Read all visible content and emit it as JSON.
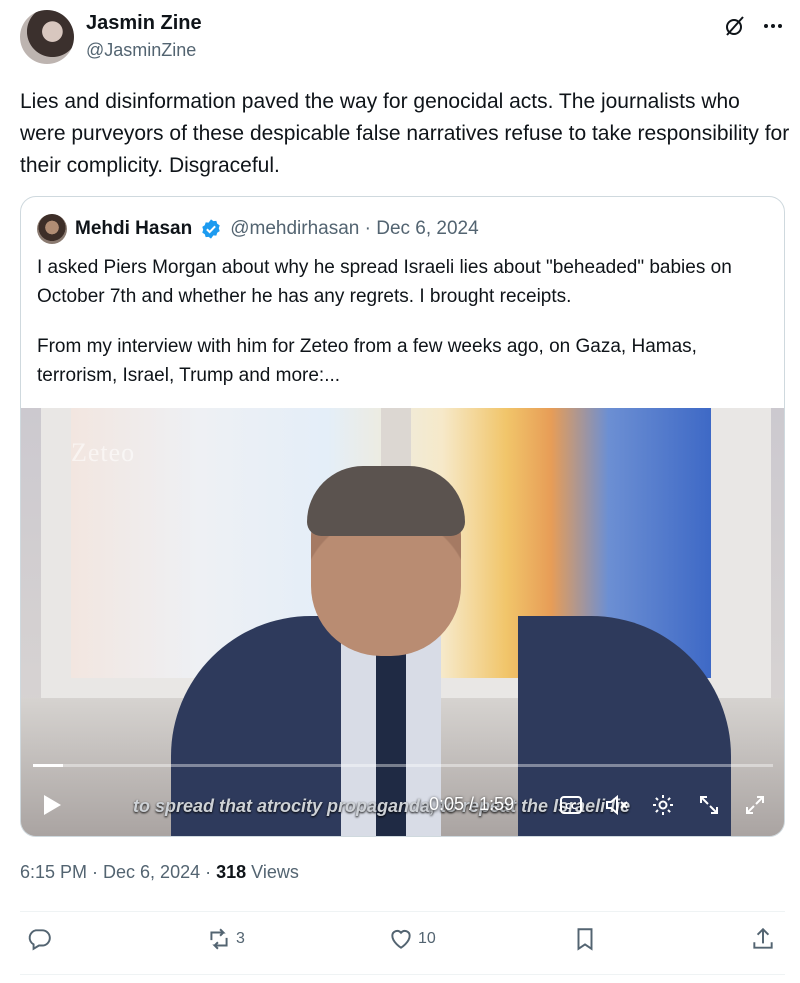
{
  "author": {
    "name": "Jasmin Zine",
    "handle": "@JasminZine"
  },
  "header_icons": [
    "grok-icon",
    "more-icon"
  ],
  "tweet": {
    "text": "Lies and disinformation paved the way for genocidal acts. The journalists who were purveyors of these despicable false narratives refuse to take responsibility for their complicity. Disgraceful."
  },
  "quote": {
    "name": "Mehdi Hasan",
    "meta": "@mehdirhasan · Dec 6, 2024",
    "paragraph1": "I asked Piers Morgan about why he spread Israeli lies about \"beheaded\" babies on October 7th and whether he has any regrets. I brought receipts.",
    "paragraph2": "From my interview with him for Zeteo from a few weeks ago, on Gaza, Hamas, terrorism, Israel, Trump and more:..."
  },
  "video": {
    "logo": "Zeteo",
    "subtitle": "to spread that atrocity propaganda, to repeat the Israeli lie",
    "time": "0:05 / 1:59",
    "progress": 0.04
  },
  "meta": {
    "time": "6:15 PM · Dec 6, 2024 · ",
    "views_count": "318",
    "views_label": " Views"
  },
  "actions": {
    "reply": "",
    "retweet": "3",
    "like": "10"
  },
  "colors": {
    "text": "#0f1419",
    "secondary": "#536471",
    "verified": "#1d9bf0",
    "border": "#cfd9de"
  }
}
